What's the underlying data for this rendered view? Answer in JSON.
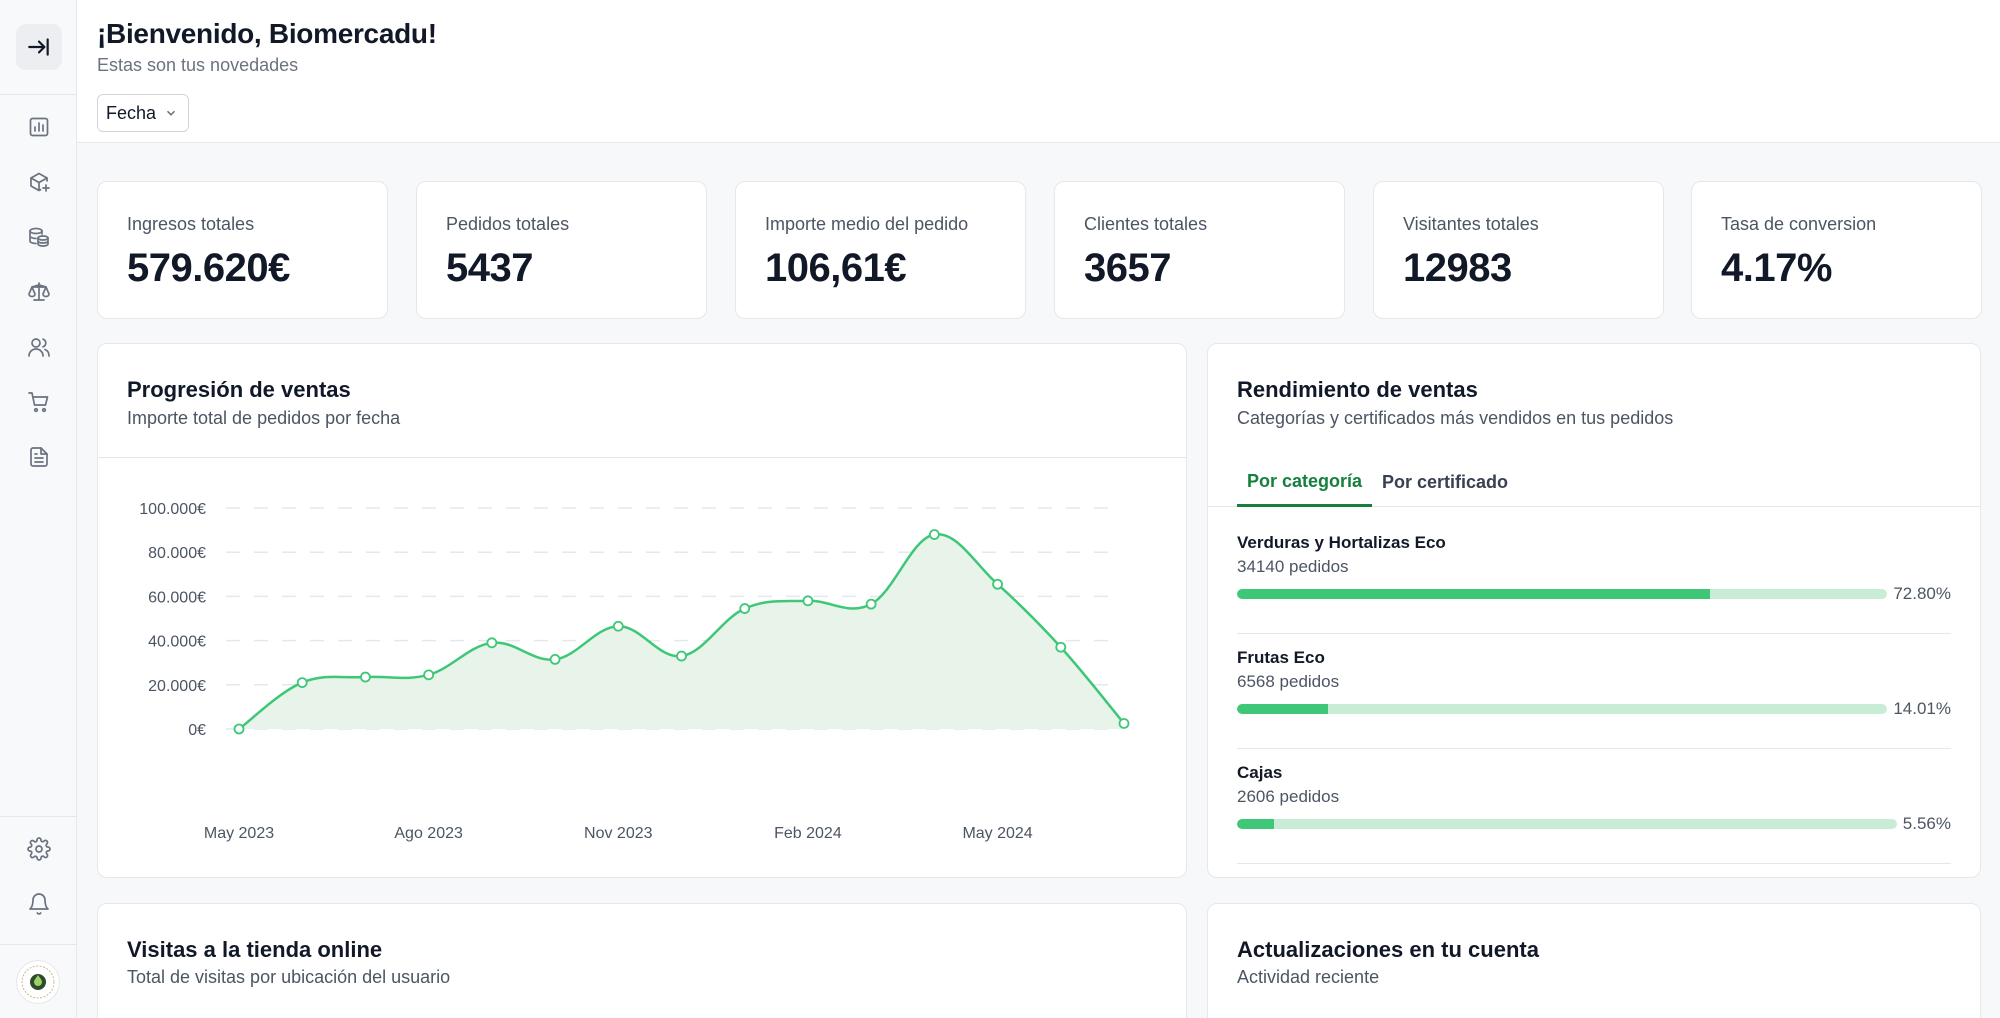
{
  "header": {
    "greeting": "¡Bienvenido, Biomercadu!",
    "subtitle": "Estas son tus novedades",
    "date_filter_label": "Fecha"
  },
  "sidebar": {
    "toggle_icon": "collapse-arrow-icon",
    "items": [
      {
        "icon": "bar-chart-icon"
      },
      {
        "icon": "package-plus-icon"
      },
      {
        "icon": "database-coins-icon"
      },
      {
        "icon": "scale-icon"
      },
      {
        "icon": "users-icon"
      },
      {
        "icon": "cart-icon"
      },
      {
        "icon": "document-icon"
      }
    ],
    "bottom_items": [
      {
        "icon": "gear-icon"
      },
      {
        "icon": "bell-icon"
      }
    ]
  },
  "stats": [
    {
      "label": "Ingresos totales",
      "value": "579.620€"
    },
    {
      "label": "Pedidos totales",
      "value": "5437"
    },
    {
      "label": "Importe medio del pedido",
      "value": "106,61€"
    },
    {
      "label": "Clientes totales",
      "value": "3657"
    },
    {
      "label": "Visitantes totales",
      "value": "12983"
    },
    {
      "label": "Tasa de conversion",
      "value": "4.17%"
    }
  ],
  "sales_progress": {
    "title": "Progresión de ventas",
    "subtitle": "Importe total de pedidos por fecha"
  },
  "chart_data": {
    "type": "area",
    "title": "",
    "xlabel": "",
    "ylabel": "",
    "ylim": [
      0,
      100000
    ],
    "y_ticks": [
      "100.000€",
      "80.000€",
      "60.000€",
      "40.000€",
      "20.000€",
      "0€"
    ],
    "y_tick_values": [
      100000,
      80000,
      60000,
      40000,
      20000,
      0
    ],
    "x_tick_labels": [
      "May 2023",
      "Ago 2023",
      "Nov 2023",
      "Feb 2024",
      "May 2024"
    ],
    "x_tick_index": [
      0,
      3,
      6,
      9,
      12
    ],
    "grid": true,
    "color": "#3ec777",
    "fill_color": "#e8f3ea",
    "series": [
      {
        "values": [
          0,
          21000,
          23500,
          24500,
          39000,
          31500,
          46500,
          33000,
          54500,
          58000,
          56500,
          88000,
          65500,
          37000,
          2500
        ]
      }
    ]
  },
  "sales_performance": {
    "title": "Rendimiento de ventas",
    "subtitle": "Categorías y certificados más vendidos en tus pedidos",
    "tabs": [
      {
        "label": "Por categoría",
        "active": true
      },
      {
        "label": "Por certificado",
        "active": false
      }
    ],
    "items": [
      {
        "name": "Verduras y Hortalizas Eco",
        "count": "34140 pedidos",
        "percent_label": "72.80%",
        "percent": 72.8
      },
      {
        "name": "Frutas Eco",
        "count": "6568 pedidos",
        "percent_label": "14.01%",
        "percent": 14.01
      },
      {
        "name": "Cajas",
        "count": "2606 pedidos",
        "percent_label": "5.56%",
        "percent": 5.56
      }
    ]
  },
  "store_visits": {
    "title": "Visitas a la tienda online",
    "subtitle": "Total de visitas por ubicación del usuario"
  },
  "account_updates": {
    "title": "Actualizaciones en tu cuenta",
    "subtitle": "Actividad reciente"
  }
}
